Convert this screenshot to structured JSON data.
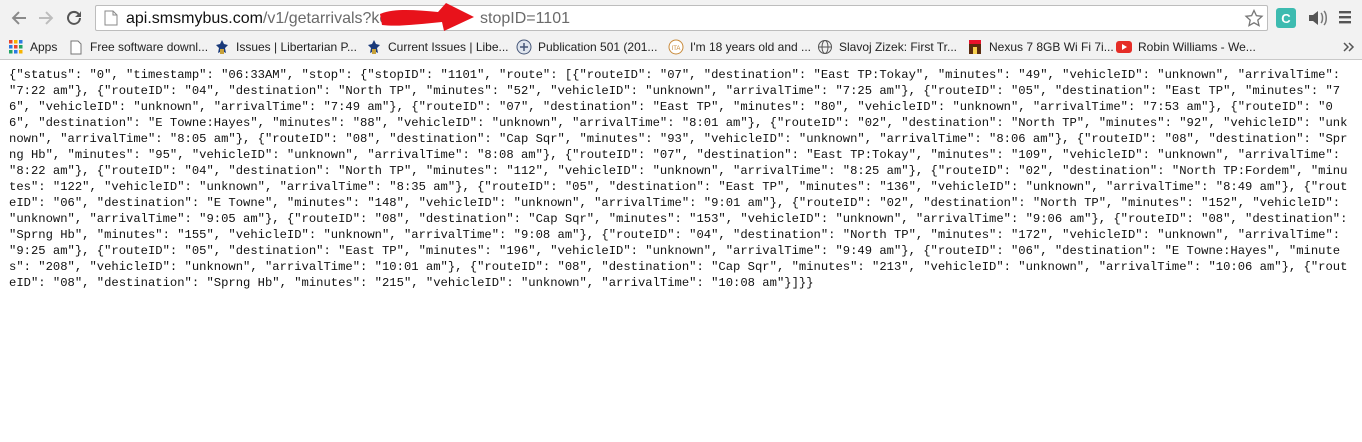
{
  "browser": {
    "url_host": "api.smsmybus.com",
    "url_path": "/v1/getarrivals?ke",
    "url_tail": "stopID=1101",
    "bookmarks": [
      {
        "label": "Apps",
        "icon": "apps-grid-icon",
        "color": "#e8442c"
      },
      {
        "label": "Free software downl...",
        "icon": "page-icon",
        "color": "#777777"
      },
      {
        "label": "Issues | Libertarian P...",
        "icon": "libertarian-logo-icon",
        "color": "#1a3a7a"
      },
      {
        "label": "Current Issues | Libe...",
        "icon": "libertarian-logo-icon",
        "color": "#1a3a7a"
      },
      {
        "label": "Publication 501 (201...",
        "icon": "irs-icon",
        "color": "#445577"
      },
      {
        "label": "I'm 18 years old and ...",
        "icon": "ita-icon",
        "color": "#c88a3a"
      },
      {
        "label": "Slavoj Zizek: First Tr...",
        "icon": "globe-icon",
        "color": "#555555"
      },
      {
        "label": "Nexus 7 8GB Wi Fi 7i...",
        "icon": "store-icon",
        "color": "#5a2b0f"
      },
      {
        "label": "Robin Williams - We...",
        "icon": "youtube-icon",
        "color": "#e52d27"
      }
    ]
  },
  "page": {
    "body_text": "{\"status\": \"0\", \"timestamp\": \"06:33AM\", \"stop\": {\"stopID\": \"1101\", \"route\": [{\"routeID\": \"07\", \"destination\": \"East TP:Tokay\", \"minutes\": \"49\", \"vehicleID\": \"unknown\", \"arrivalTime\": \"7:22 am\"}, {\"routeID\": \"04\", \"destination\": \"North TP\", \"minutes\": \"52\", \"vehicleID\": \"unknown\", \"arrivalTime\": \"7:25 am\"}, {\"routeID\": \"05\", \"destination\": \"East TP\", \"minutes\": \"76\", \"vehicleID\": \"unknown\", \"arrivalTime\": \"7:49 am\"}, {\"routeID\": \"07\", \"destination\": \"East TP\", \"minutes\": \"80\", \"vehicleID\": \"unknown\", \"arrivalTime\": \"7:53 am\"}, {\"routeID\": \"06\", \"destination\": \"E Towne:Hayes\", \"minutes\": \"88\", \"vehicleID\": \"unknown\", \"arrivalTime\": \"8:01 am\"}, {\"routeID\": \"02\", \"destination\": \"North TP\", \"minutes\": \"92\", \"vehicleID\": \"unknown\", \"arrivalTime\": \"8:05 am\"}, {\"routeID\": \"08\", \"destination\": \"Cap Sqr\", \"minutes\": \"93\", \"vehicleID\": \"unknown\", \"arrivalTime\": \"8:06 am\"}, {\"routeID\": \"08\", \"destination\": \"Sprng Hb\", \"minutes\": \"95\", \"vehicleID\": \"unknown\", \"arrivalTime\": \"8:08 am\"}, {\"routeID\": \"07\", \"destination\": \"East TP:Tokay\", \"minutes\": \"109\", \"vehicleID\": \"unknown\", \"arrivalTime\": \"8:22 am\"}, {\"routeID\": \"04\", \"destination\": \"North TP\", \"minutes\": \"112\", \"vehicleID\": \"unknown\", \"arrivalTime\": \"8:25 am\"}, {\"routeID\": \"02\", \"destination\": \"North TP:Fordem\", \"minutes\": \"122\", \"vehicleID\": \"unknown\", \"arrivalTime\": \"8:35 am\"}, {\"routeID\": \"05\", \"destination\": \"East TP\", \"minutes\": \"136\", \"vehicleID\": \"unknown\", \"arrivalTime\": \"8:49 am\"}, {\"routeID\": \"06\", \"destination\": \"E Towne\", \"minutes\": \"148\", \"vehicleID\": \"unknown\", \"arrivalTime\": \"9:01 am\"}, {\"routeID\": \"02\", \"destination\": \"North TP\", \"minutes\": \"152\", \"vehicleID\": \"unknown\", \"arrivalTime\": \"9:05 am\"}, {\"routeID\": \"08\", \"destination\": \"Cap Sqr\", \"minutes\": \"153\", \"vehicleID\": \"unknown\", \"arrivalTime\": \"9:06 am\"}, {\"routeID\": \"08\", \"destination\": \"Sprng Hb\", \"minutes\": \"155\", \"vehicleID\": \"unknown\", \"arrivalTime\": \"9:08 am\"}, {\"routeID\": \"04\", \"destination\": \"North TP\", \"minutes\": \"172\", \"vehicleID\": \"unknown\", \"arrivalTime\": \"9:25 am\"}, {\"routeID\": \"05\", \"destination\": \"East TP\", \"minutes\": \"196\", \"vehicleID\": \"unknown\", \"arrivalTime\": \"9:49 am\"}, {\"routeID\": \"06\", \"destination\": \"E Towne:Hayes\", \"minutes\": \"208\", \"vehicleID\": \"unknown\", \"arrivalTime\": \"10:01 am\"}, {\"routeID\": \"08\", \"destination\": \"Cap Sqr\", \"minutes\": \"213\", \"vehicleID\": \"unknown\", \"arrivalTime\": \"10:06 am\"}, {\"routeID\": \"08\", \"destination\": \"Sprng Hb\", \"minutes\": \"215\", \"vehicleID\": \"unknown\", \"arrivalTime\": \"10:08 am\"}]}}"
  },
  "colors": {
    "redaction": "#e8121b",
    "extension_badge": "#3dbbb0"
  }
}
